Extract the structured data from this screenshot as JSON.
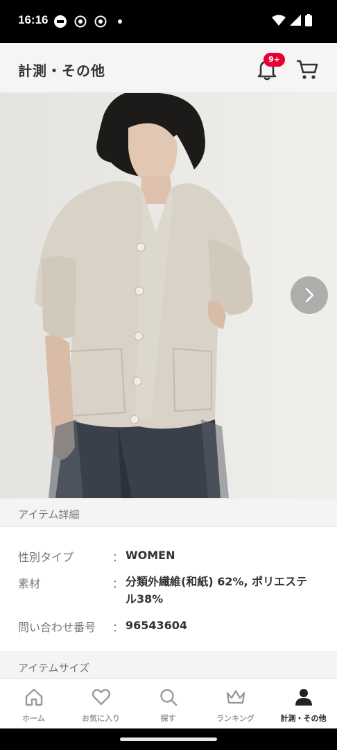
{
  "status_bar": {
    "time": "16:16",
    "icons": [
      "app-notification-icon",
      "chrome-icon",
      "chrome-icon",
      "dot-icon",
      "wifi-icon",
      "signal-icon",
      "battery-icon"
    ]
  },
  "header": {
    "title": "計測・その他",
    "notification_badge": "9+"
  },
  "hero": {
    "next_icon": "chevron-right-icon"
  },
  "item_details": {
    "heading": "アイテム詳細",
    "rows": [
      {
        "label": "性別タイプ",
        "value": "WOMEN"
      },
      {
        "label": "素材",
        "value_line1": "分類外繊維(和紙) 62%, ポリエステ",
        "value_line2": "ル38%"
      },
      {
        "label": "問い合わせ番号",
        "value": "96543604"
      }
    ],
    "colon": "："
  },
  "item_size": {
    "heading": "アイテムサイズ"
  },
  "bottom_nav": {
    "items": [
      {
        "label": "ホーム",
        "icon": "home-icon"
      },
      {
        "label": "お気に入り",
        "icon": "heart-icon"
      },
      {
        "label": "探す",
        "icon": "search-icon"
      },
      {
        "label": "ランキング",
        "icon": "crown-icon"
      },
      {
        "label": "計測・その他",
        "icon": "person-icon"
      }
    ],
    "active_index": 4
  },
  "colors": {
    "badge": "#e60033",
    "header_bg": "#f5f5f5",
    "section_bg": "#f4f4f4",
    "active_nav": "#222222",
    "inactive_nav": "#9a9a9a"
  }
}
